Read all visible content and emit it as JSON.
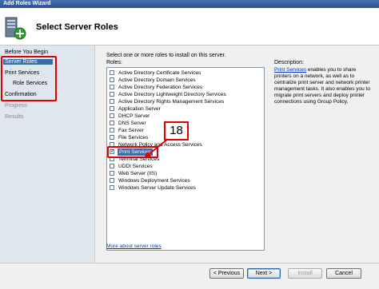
{
  "window": {
    "title": "Add Roles Wizard"
  },
  "header": {
    "title": "Select Server Roles",
    "icon": "server-roles-icon"
  },
  "nav": {
    "items": [
      {
        "label": "Before You Begin",
        "state": "normal"
      },
      {
        "label": "Server Roles",
        "state": "active"
      },
      {
        "label": "Print Services",
        "state": "normal"
      },
      {
        "label": "Role Services",
        "state": "normal"
      },
      {
        "label": "Confirmation",
        "state": "normal"
      },
      {
        "label": "Progress",
        "state": "disabled"
      },
      {
        "label": "Results",
        "state": "disabled"
      }
    ]
  },
  "main": {
    "intro": "Select one or more roles to install on this server.",
    "roles_label": "Roles:",
    "roles": [
      {
        "label": "Active Directory Certificate Services",
        "checked": false
      },
      {
        "label": "Active Directory Domain Services",
        "checked": false
      },
      {
        "label": "Active Directory Federation Services",
        "checked": false
      },
      {
        "label": "Active Directory Lightweight Directory Services",
        "checked": false
      },
      {
        "label": "Active Directory Rights Management Services",
        "checked": false
      },
      {
        "label": "Application Server",
        "checked": false
      },
      {
        "label": "DHCP Server",
        "checked": false
      },
      {
        "label": "DNS Server",
        "checked": false
      },
      {
        "label": "Fax Server",
        "checked": false
      },
      {
        "label": "File Services",
        "checked": false
      },
      {
        "label": "Network Policy and Access Services",
        "checked": false
      },
      {
        "label": "Print Services",
        "checked": true
      },
      {
        "label": "Terminal Services",
        "checked": false
      },
      {
        "label": "UDDI Services",
        "checked": false
      },
      {
        "label": "Web Server (IIS)",
        "checked": false
      },
      {
        "label": "Windows Deployment Services",
        "checked": false
      },
      {
        "label": "Windows Server Update Services",
        "checked": false
      }
    ],
    "description_title": "Description:",
    "description_link": "Print Services",
    "description_text": " enables you to share printers on a network, as well as to centralize print server and network printer management tasks. It also enables you to migrate print servers and deploy printer connections using Group Policy.",
    "more_link": "More about server roles"
  },
  "buttons": {
    "previous": "< Previous",
    "next": "Next >",
    "install": "Install",
    "cancel": "Cancel"
  },
  "annotation": {
    "step_number": "18",
    "color": "#e00000"
  }
}
